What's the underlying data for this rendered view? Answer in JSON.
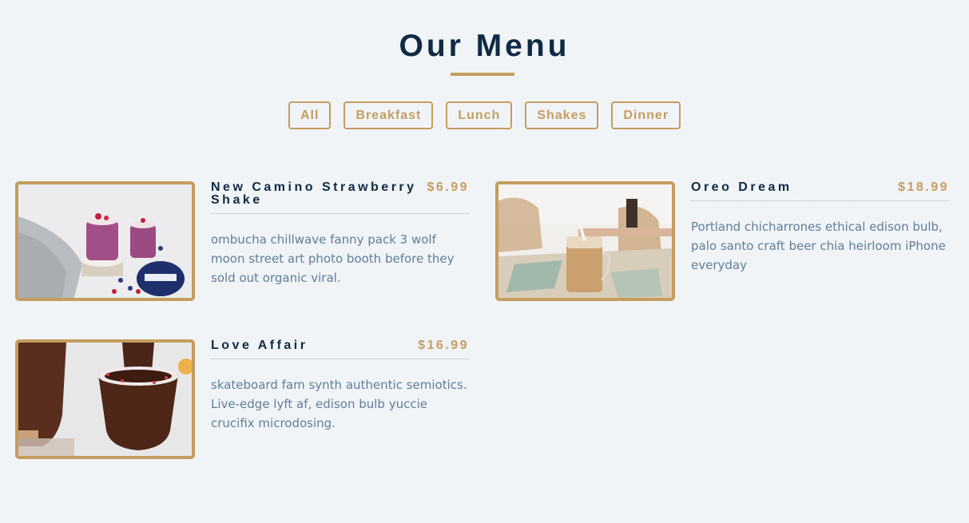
{
  "header": {
    "title": "Our Menu"
  },
  "filters": [
    "All",
    "Breakfast",
    "Lunch",
    "Shakes",
    "Dinner"
  ],
  "menu": [
    {
      "name": "New Camino Strawberry Shake",
      "price": "$6.99",
      "description": "ombucha chillwave fanny pack 3 wolf moon street art photo booth before they sold out organic viral.",
      "image": "strawberry-shake-photo"
    },
    {
      "name": "Oreo Dream",
      "price": "$18.99",
      "description": "Portland chicharrones ethical edison bulb, palo santo craft beer chia heirloom iPhone everyday",
      "image": "iced-coffee-photo"
    },
    {
      "name": "Love Affair",
      "price": "$16.99",
      "description": "skateboard fam synth authentic semiotics. Live-edge lyft af, edison bulb yuccie crucifix microdosing.",
      "image": "chocolate-drink-photo"
    }
  ],
  "colors": {
    "accent": "#c59d5f",
    "heading": "#102a43",
    "body_text": "#617d98",
    "background": "#f0f4f7"
  }
}
